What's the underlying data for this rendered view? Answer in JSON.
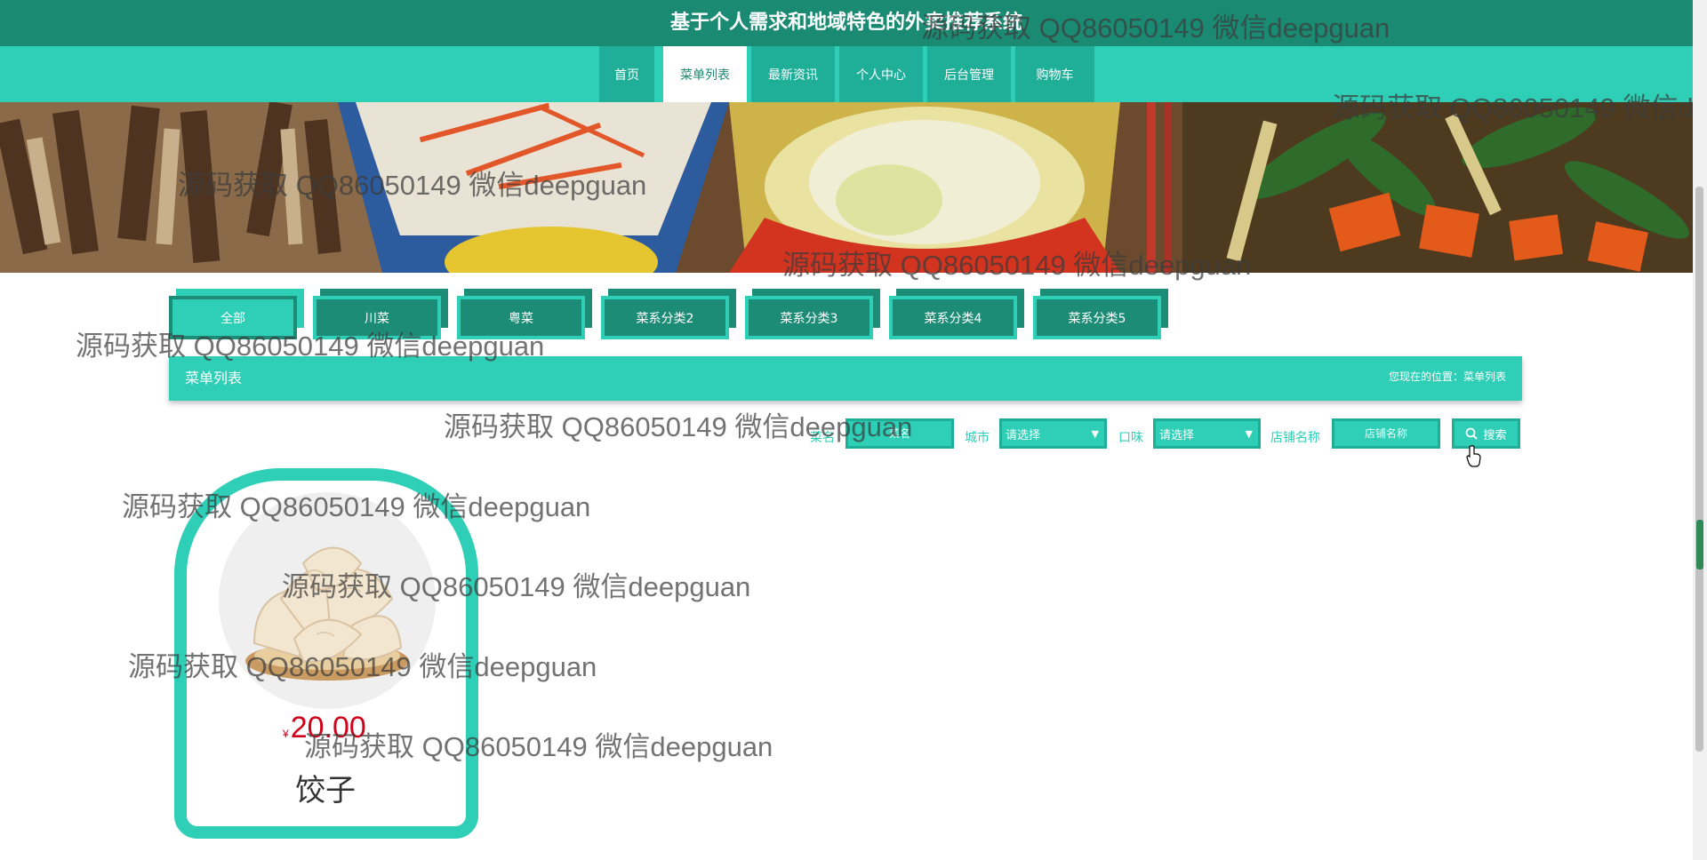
{
  "header": {
    "title": "基于个人需求和地域特色的外卖推荐系统"
  },
  "nav": {
    "items": [
      {
        "label": "首页"
      },
      {
        "label": "菜单列表"
      },
      {
        "label": "最新资讯"
      },
      {
        "label": "个人中心"
      },
      {
        "label": "后台管理"
      },
      {
        "label": "购物车"
      }
    ],
    "active": "菜单列表"
  },
  "categories": {
    "items": [
      {
        "label": "全部"
      },
      {
        "label": "川菜"
      },
      {
        "label": "粤菜"
      },
      {
        "label": "菜系分类2"
      },
      {
        "label": "菜系分类3"
      },
      {
        "label": "菜系分类4"
      },
      {
        "label": "菜系分类5"
      }
    ],
    "active": "全部"
  },
  "section": {
    "title": "菜单列表",
    "breadcrumb": "您现在的位置：菜单列表"
  },
  "search": {
    "dish_label": "菜名",
    "dish_placeholder": "菜名",
    "city_label": "城市",
    "city_value": "请选择",
    "taste_label": "口味",
    "taste_value": "请选择",
    "shop_label": "店铺名称",
    "shop_placeholder": "店铺名称",
    "button_label": "搜索"
  },
  "products": [
    {
      "currency": "¥",
      "price": "20.00",
      "name": "饺子"
    }
  ],
  "watermark": "源码获取 QQ86050149 微信deepguan",
  "colors": {
    "header_dark": "#1b8a73",
    "accent": "#2ecfb6",
    "accent_dark": "#1d8c76",
    "price": "#d0021b"
  }
}
